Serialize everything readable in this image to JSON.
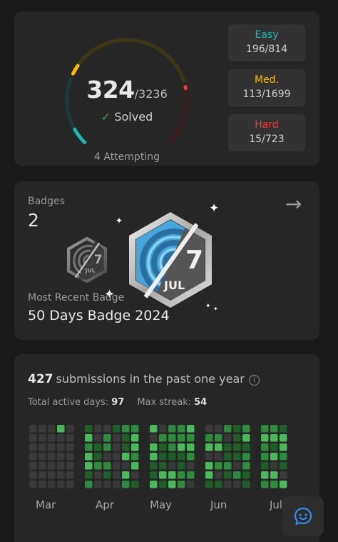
{
  "progress": {
    "solved": "324",
    "total": "/3236",
    "solved_label": "Solved",
    "attempting": "4 Attempting",
    "difficulties": [
      {
        "label": "Easy",
        "value": "196/814",
        "color": "#1cb8b8"
      },
      {
        "label": "Med.",
        "value": "113/1699",
        "color": "#ffb800"
      },
      {
        "label": "Hard",
        "value": "15/723",
        "color": "#f63737"
      }
    ]
  },
  "badges": {
    "title": "Badges",
    "count": "2",
    "most_recent_label": "Most Recent Badge",
    "most_recent_name": "50 Days Badge 2024",
    "badge_number": "7",
    "badge_month": "JUL"
  },
  "submissions": {
    "count": "427",
    "text": "submissions in the past one year",
    "info_glyph": "i",
    "active_days_label": "Total active days:",
    "active_days": "97",
    "max_streak_label": "Max streak:",
    "max_streak": "54",
    "months": [
      "Mar",
      "Apr",
      "May",
      "Jun",
      "Jul"
    ]
  },
  "colors": {
    "easy": "#1cb8b8",
    "medium": "#ffb800",
    "hard": "#f63737",
    "heat_empty": "#393939",
    "heat_levels": [
      "#1f5d2a",
      "#2e8b3e",
      "#4cb85c"
    ]
  }
}
